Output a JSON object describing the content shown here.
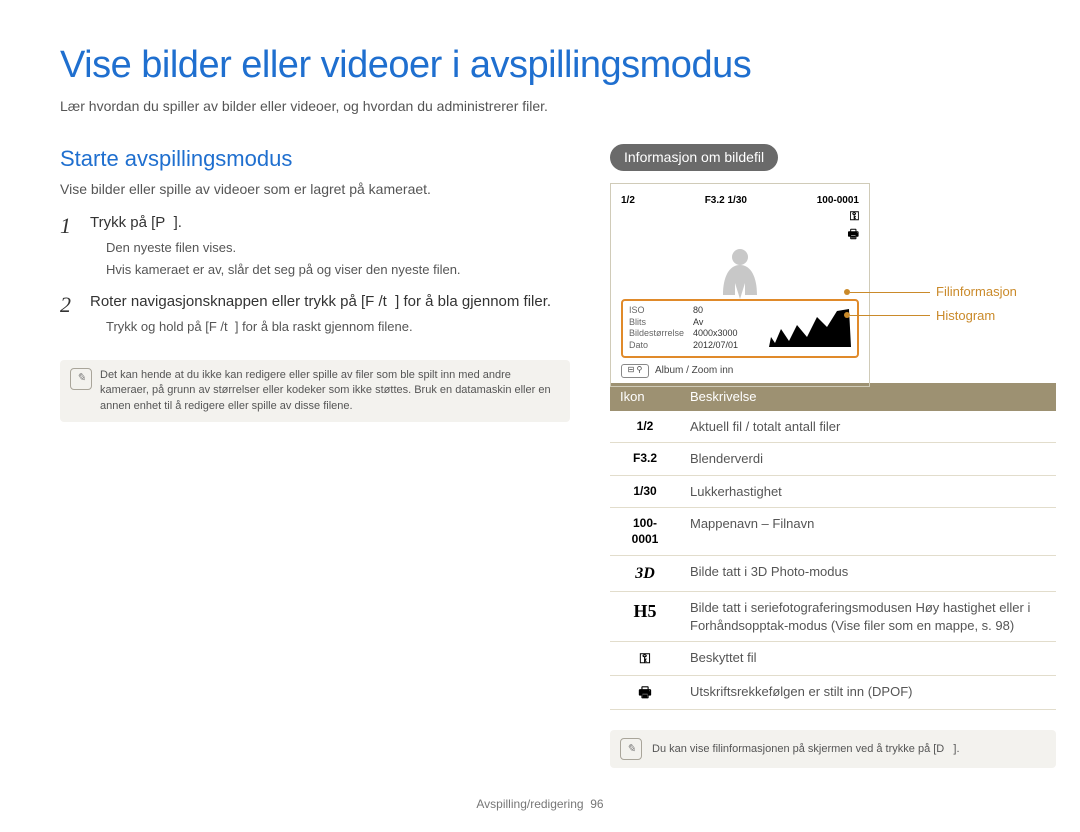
{
  "page": {
    "title": "Vise bilder eller videoer i avspillingsmodus",
    "intro": "Lær hvordan du spiller av bilder eller videoer, og hvordan du administrerer filer."
  },
  "left": {
    "heading": "Starte avspillingsmodus",
    "sub": "Vise bilder eller spille av videoer som er lagret på kameraet.",
    "step1_title": "Trykk på [P  ].",
    "step1_d1": "Den nyeste filen vises.",
    "step1_d2": "Hvis kameraet er av, slår det seg på og viser den nyeste filen.",
    "step2_title": "Roter navigasjonsknappen eller trykk på [F /t  ] for å bla gjennom filer.",
    "step2_d1": "Trykk og hold på [F /t  ] for å bla raskt gjennom filene.",
    "note": "Det kan hende at du ikke kan redigere eller spille av filer som ble spilt inn med andre kameraer, på grunn av størrelser eller kodeker som ikke støttes. Bruk en datamaskin eller en annen enhet til å redigere eller spille av disse filene."
  },
  "right": {
    "pill": "Informasjon om bildefil",
    "diagram": {
      "top_left": "1/2",
      "top_mid": "F3.2 1/30",
      "top_right": "100-0001",
      "lock": "⚿",
      "printer": "🖶",
      "info": {
        "iso_l": "ISO",
        "iso_v": "80",
        "flash_l": "Blits",
        "flash_v": "Av",
        "size_l": "Bildestørrelse",
        "size_v": "4000x3000",
        "date_l": "Dato",
        "date_v": "2012/07/01"
      },
      "album": "Album / Zoom inn"
    },
    "callouts": {
      "fileinfo": "Filinformasjon",
      "histogram": "Histogram"
    },
    "table": {
      "h1": "Ikon",
      "h2": "Beskrivelse",
      "rows": [
        {
          "icon": "1/2",
          "desc": "Aktuell fil / totalt antall filer"
        },
        {
          "icon": "F3.2",
          "desc": "Blenderverdi"
        },
        {
          "icon": "1/30",
          "desc": "Lukkerhastighet"
        },
        {
          "icon": "100-0001",
          "desc": "Mappenavn – Filnavn"
        },
        {
          "icon": "3D",
          "desc": "Bilde tatt i 3D Photo-modus",
          "style": "3d"
        },
        {
          "icon": "H5",
          "desc": "Bilde tatt i seriefotograferingsmodusen Høy hastighet eller i Forhåndsopptak-modus (Vise filer som en mappe, s. 98)",
          "style": "hs"
        },
        {
          "icon": "⚿",
          "desc": "Beskyttet fil",
          "style": "lock"
        },
        {
          "icon": "🖶",
          "desc": "Utskriftsrekkefølgen er stilt inn (DPOF)",
          "style": "print"
        }
      ]
    },
    "note": "Du kan vise filinformasjonen på skjermen ved å trykke på [D   ]."
  },
  "footer": {
    "section": "Avspilling/redigering",
    "pagenum": "96"
  }
}
